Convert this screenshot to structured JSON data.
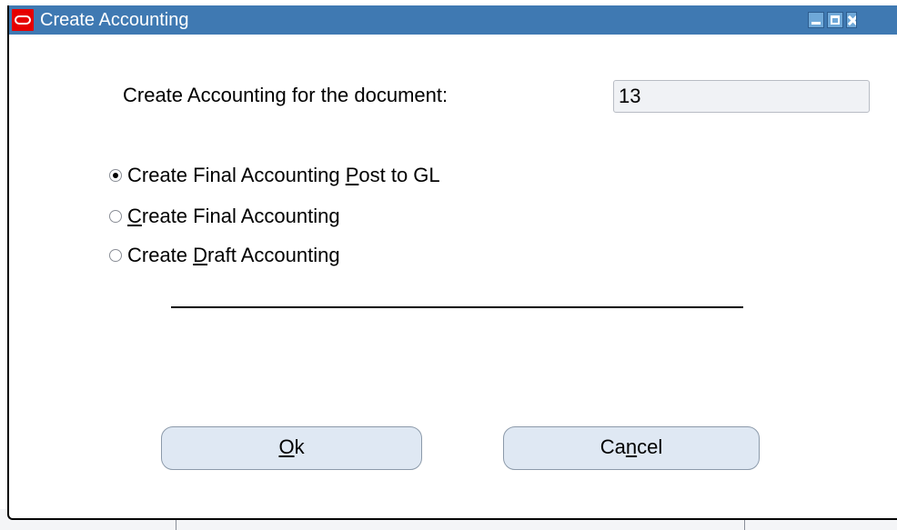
{
  "window": {
    "title": "Create Accounting",
    "controls": [
      "minimize-icon",
      "maximize-icon",
      "close-icon"
    ],
    "titlebar_color": "#3f79b2"
  },
  "form": {
    "document_label": "Create Accounting for the document:",
    "document_value": "13"
  },
  "options": [
    {
      "pre": "Create Final Accounting ",
      "u": "P",
      "post": "ost to GL",
      "checked": true
    },
    {
      "pre": "",
      "u": "C",
      "post": "reate Final Accounting",
      "checked": false
    },
    {
      "pre": "Create ",
      "u": "D",
      "post": "raft Accounting",
      "checked": false
    }
  ],
  "buttons": {
    "ok": {
      "pre": "",
      "u": "O",
      "post": "k"
    },
    "cancel": {
      "pre": "Ca",
      "u": "n",
      "post": "cel"
    }
  }
}
